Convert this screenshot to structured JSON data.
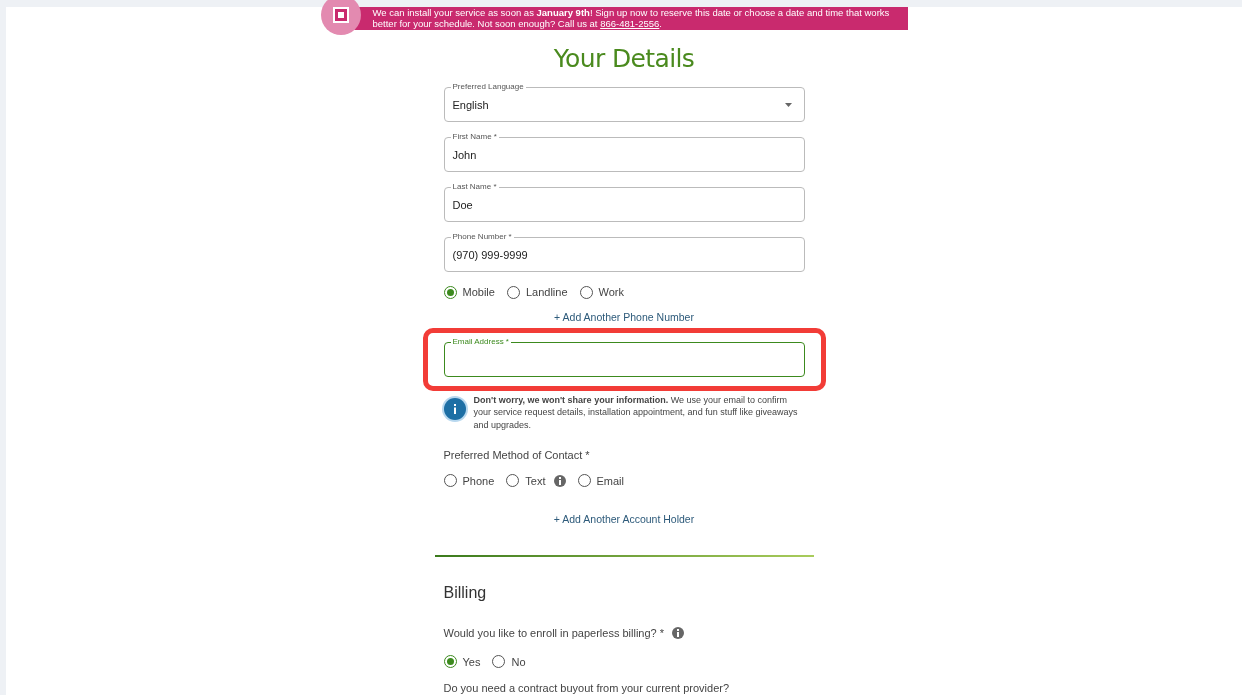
{
  "banner": {
    "text": "We can install your service as soon as **January 9th**! Sign up now to reserve this date or choose a date and time that works better for your schedule. Not soon enough? Call us at ",
    "link": "866-481-2556",
    "after": "."
  },
  "heading": "Your Details",
  "fields": [
    {
      "kind": "select",
      "label": "Preferred Language",
      "value": "English",
      "focused": false
    },
    {
      "kind": "text",
      "label": "First Name *",
      "value": "John",
      "focused": false
    },
    {
      "kind": "text",
      "label": "Last Name *",
      "value": "Doe",
      "focused": false
    },
    {
      "kind": "text",
      "label": "Phone Number *",
      "value": "(970) 999-9999",
      "focused": false
    }
  ],
  "phone_types": [
    {
      "label": "Mobile",
      "selected": true
    },
    {
      "label": "Landline",
      "selected": false
    },
    {
      "label": "Work",
      "selected": false
    }
  ],
  "add_phone": "+ Add Another Phone Number",
  "email": {
    "label": "Email Address *",
    "focused": true
  },
  "email_note": "**Don't worry, we won't share your information.** We use your email to confirm your service request details, installation appointment, and fun stuff like giveaways and upgrades.",
  "contact": {
    "label": "Preferred Method of Contact *",
    "options": [
      {
        "label": "Phone",
        "selected": false,
        "info": false
      },
      {
        "label": "Text",
        "selected": false,
        "info": true
      },
      {
        "label": "Email",
        "selected": false,
        "info": false
      }
    ]
  },
  "add_holder": "+ Add Another Account Holder",
  "billing": {
    "title": "Billing",
    "question": "Would you like to enroll in paperless billing? *",
    "options": [
      {
        "label": "Yes",
        "selected": true
      },
      {
        "label": "No",
        "selected": false
      }
    ],
    "next_question": "Do you need a contract buyout from your current provider?"
  }
}
